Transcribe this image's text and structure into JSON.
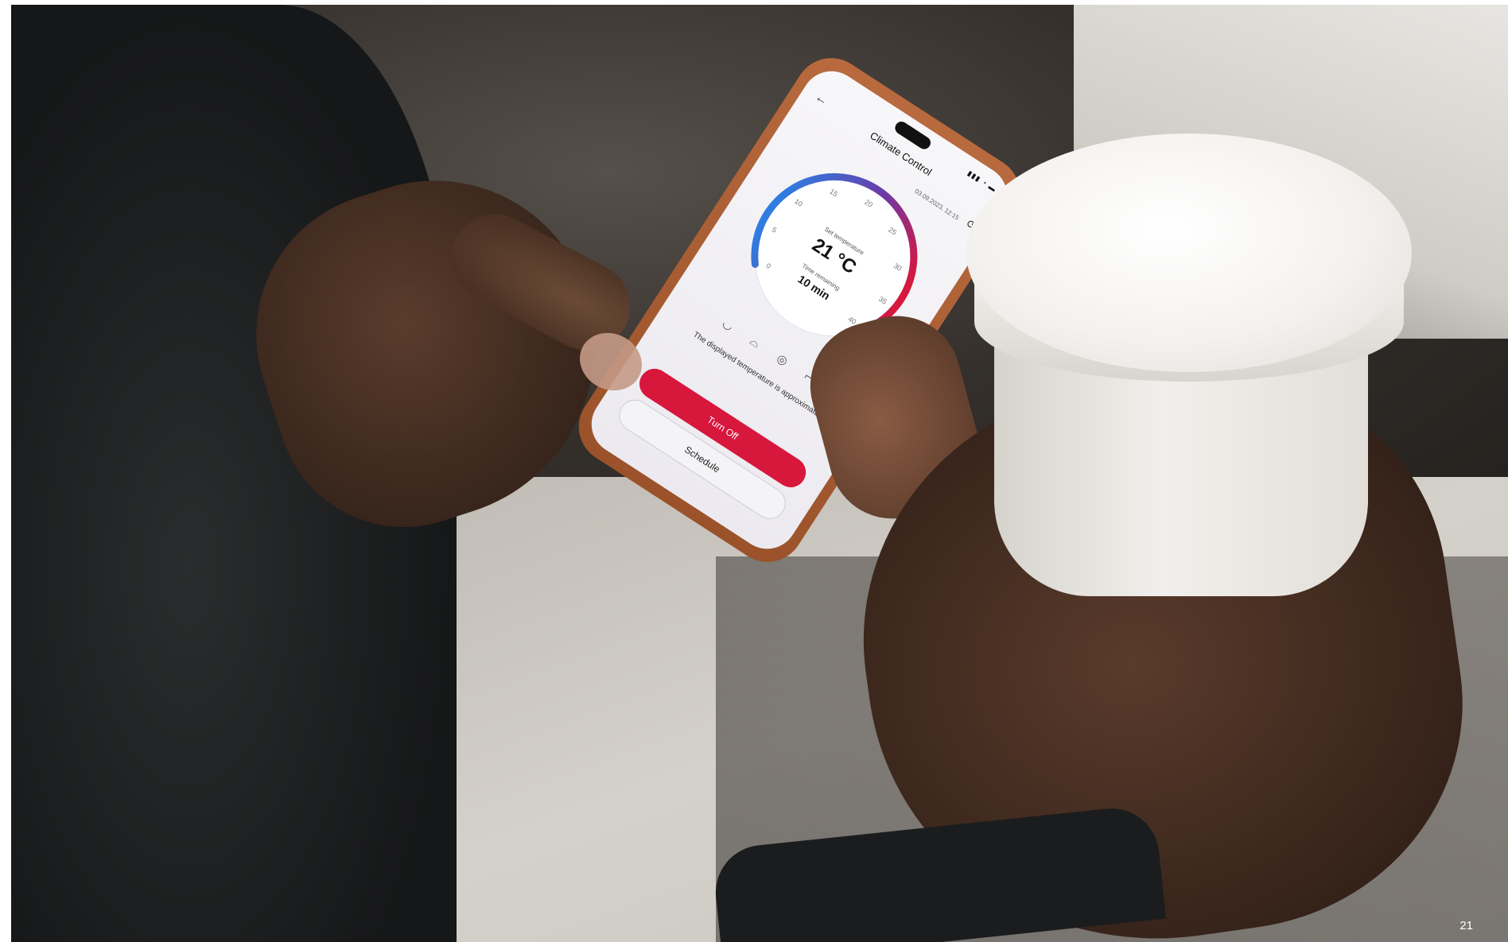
{
  "phone_app": {
    "title": "Climate Control",
    "timestamp": "03.09.2023, 12:15",
    "gauge": {
      "set_label": "Set temperature",
      "set_value": "21 °C",
      "time_label": "Time remaining",
      "time_value": "10 min",
      "ticks": [
        "0",
        "5",
        "10",
        "15",
        "20",
        "25",
        "30",
        "35",
        "40"
      ]
    },
    "seat_icons": [
      "seat-heat-icon",
      "windshield-heat-icon",
      "steering-heat-icon",
      "rear-seat-heat-icon"
    ],
    "disclaimer": "The displayed temperature is approximate.",
    "primary_button": "Turn Off",
    "secondary_button": "Schedule",
    "colors": {
      "gauge_start": "#2f7de1",
      "gauge_mid": "#6b3aa8",
      "gauge_end": "#d8173d",
      "primary_button": "#d8173d",
      "phone_case": "#b86a3e"
    }
  },
  "page": {
    "number": "21"
  }
}
